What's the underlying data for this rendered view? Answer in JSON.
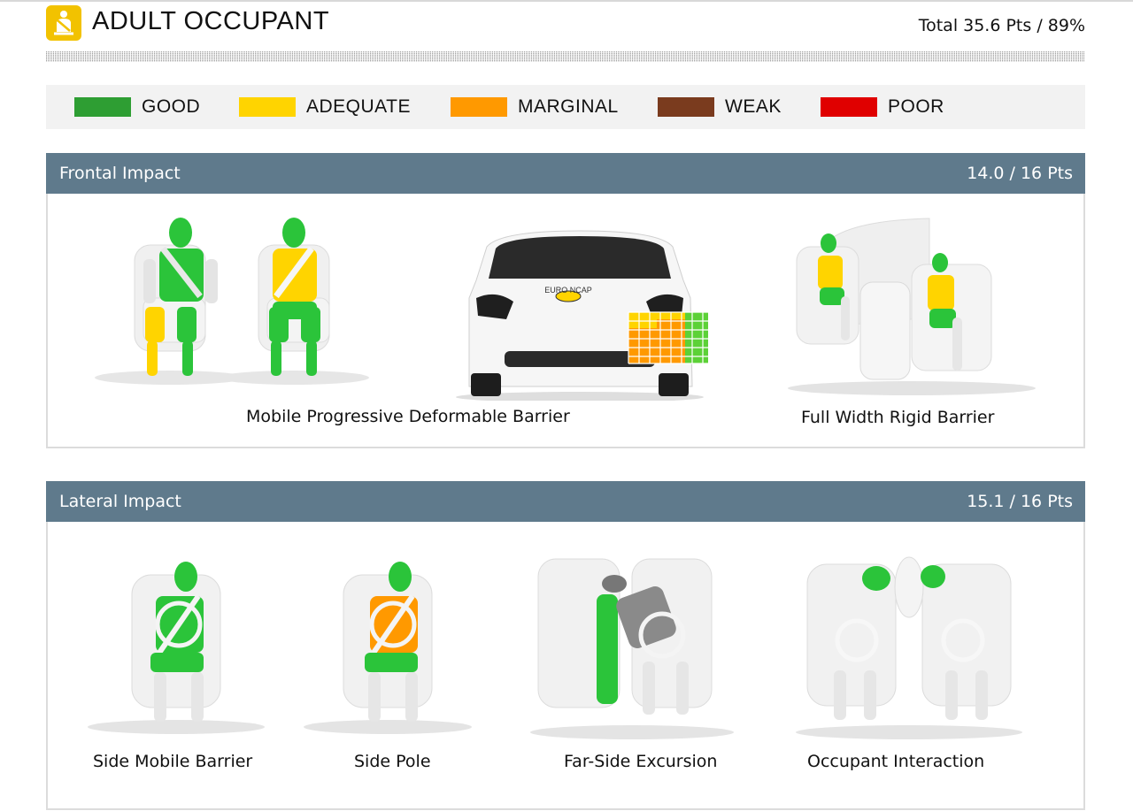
{
  "header": {
    "title": "ADULT OCCUPANT",
    "total": "Total 35.6 Pts / 89%",
    "icon": "seatbelt-occupant-icon",
    "icon_color": "#f2c200"
  },
  "legend": [
    {
      "label": "GOOD",
      "color": "#2e9e33"
    },
    {
      "label": "ADEQUATE",
      "color": "#ffd400"
    },
    {
      "label": "MARGINAL",
      "color": "#ff9900"
    },
    {
      "label": "WEAK",
      "color": "#7a3b1e"
    },
    {
      "label": "POOR",
      "color": "#e00000"
    }
  ],
  "frontal": {
    "title": "Frontal Impact",
    "points": "14.0 / 16 Pts",
    "tests": [
      {
        "label": "Mobile Progressive Deformable Barrier"
      },
      {
        "label": "Full Width Rigid Barrier"
      }
    ]
  },
  "lateral": {
    "title": "Lateral Impact",
    "points": "15.1 / 16 Pts",
    "tests": [
      {
        "label": "Side Mobile Barrier"
      },
      {
        "label": "Side Pole"
      },
      {
        "label": "Far-Side Excursion"
      },
      {
        "label": "Occupant Interaction"
      }
    ]
  },
  "car_logo": "EURO NCAP",
  "colors": {
    "bar": "#5f7a8c",
    "good": "#2e9e33",
    "adequate": "#ffd400",
    "marginal": "#ff9900"
  }
}
